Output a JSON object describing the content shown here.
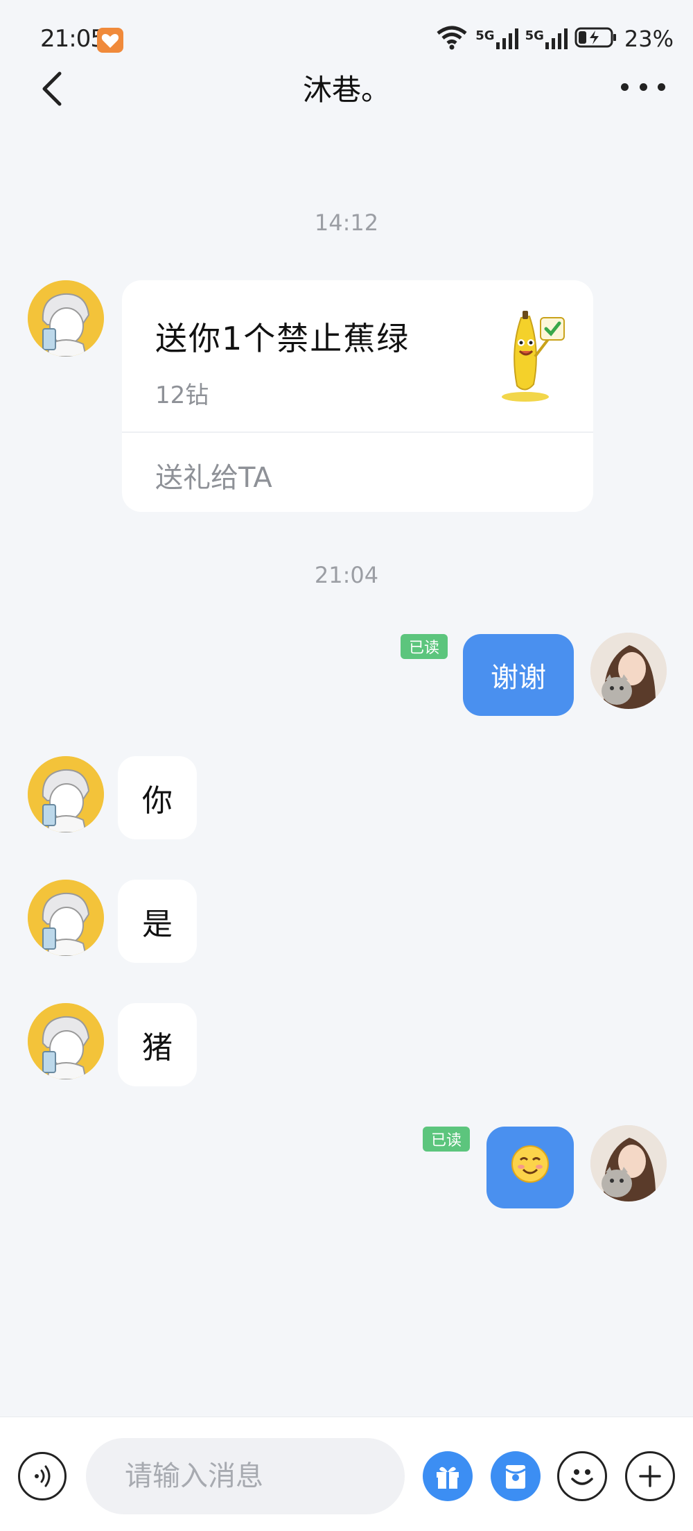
{
  "status_bar": {
    "time": "21:05",
    "network_1": "5G",
    "network_2": "5G",
    "battery": "23%"
  },
  "header": {
    "title": "沐巷。"
  },
  "messages": {
    "timestamp_1": "14:12",
    "gift_card": {
      "title": "送你1个禁止蕉绿",
      "price": "12钻",
      "action": "送礼给TA"
    },
    "timestamp_2": "21:04",
    "out_1": {
      "text": "谢谢",
      "read": "已读"
    },
    "in_1": "你",
    "in_2": "是",
    "in_3": "猪",
    "out_2": {
      "text": "☺️",
      "read": "已读"
    }
  },
  "input_bar": {
    "placeholder": "请输入消息"
  },
  "colors": {
    "accent": "#4a90ef",
    "read_badge": "#5cc57d",
    "background": "#f4f6f9"
  }
}
